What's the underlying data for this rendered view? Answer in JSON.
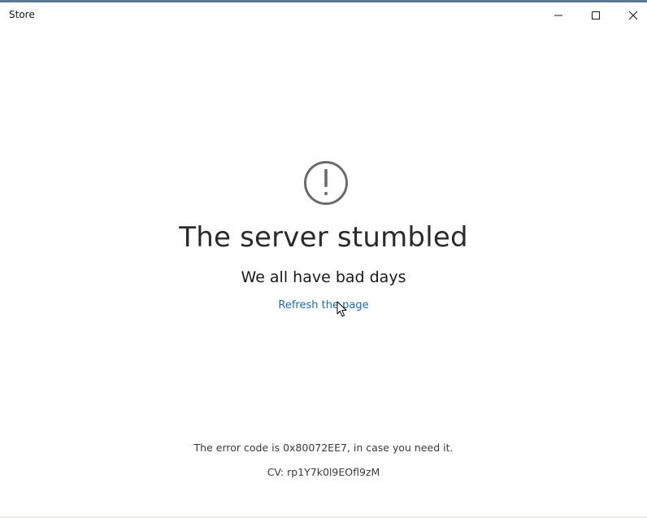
{
  "window": {
    "title": "Store",
    "accent_color": "#5a7894",
    "controls": {
      "minimize_icon": "minimize-icon",
      "maximize_icon": "maximize-icon",
      "close_icon": "close-icon"
    }
  },
  "error": {
    "icon": "exclamation-circle-icon",
    "headline": "The server stumbled",
    "subline": "We all have bad days",
    "action_label": "Refresh the page",
    "action_color": "#1a6bb5",
    "code_text": "The error code is 0x80072EE7, in case you need it.",
    "cv_text": "CV: rp1Y7k0l9EOfl9zM"
  }
}
